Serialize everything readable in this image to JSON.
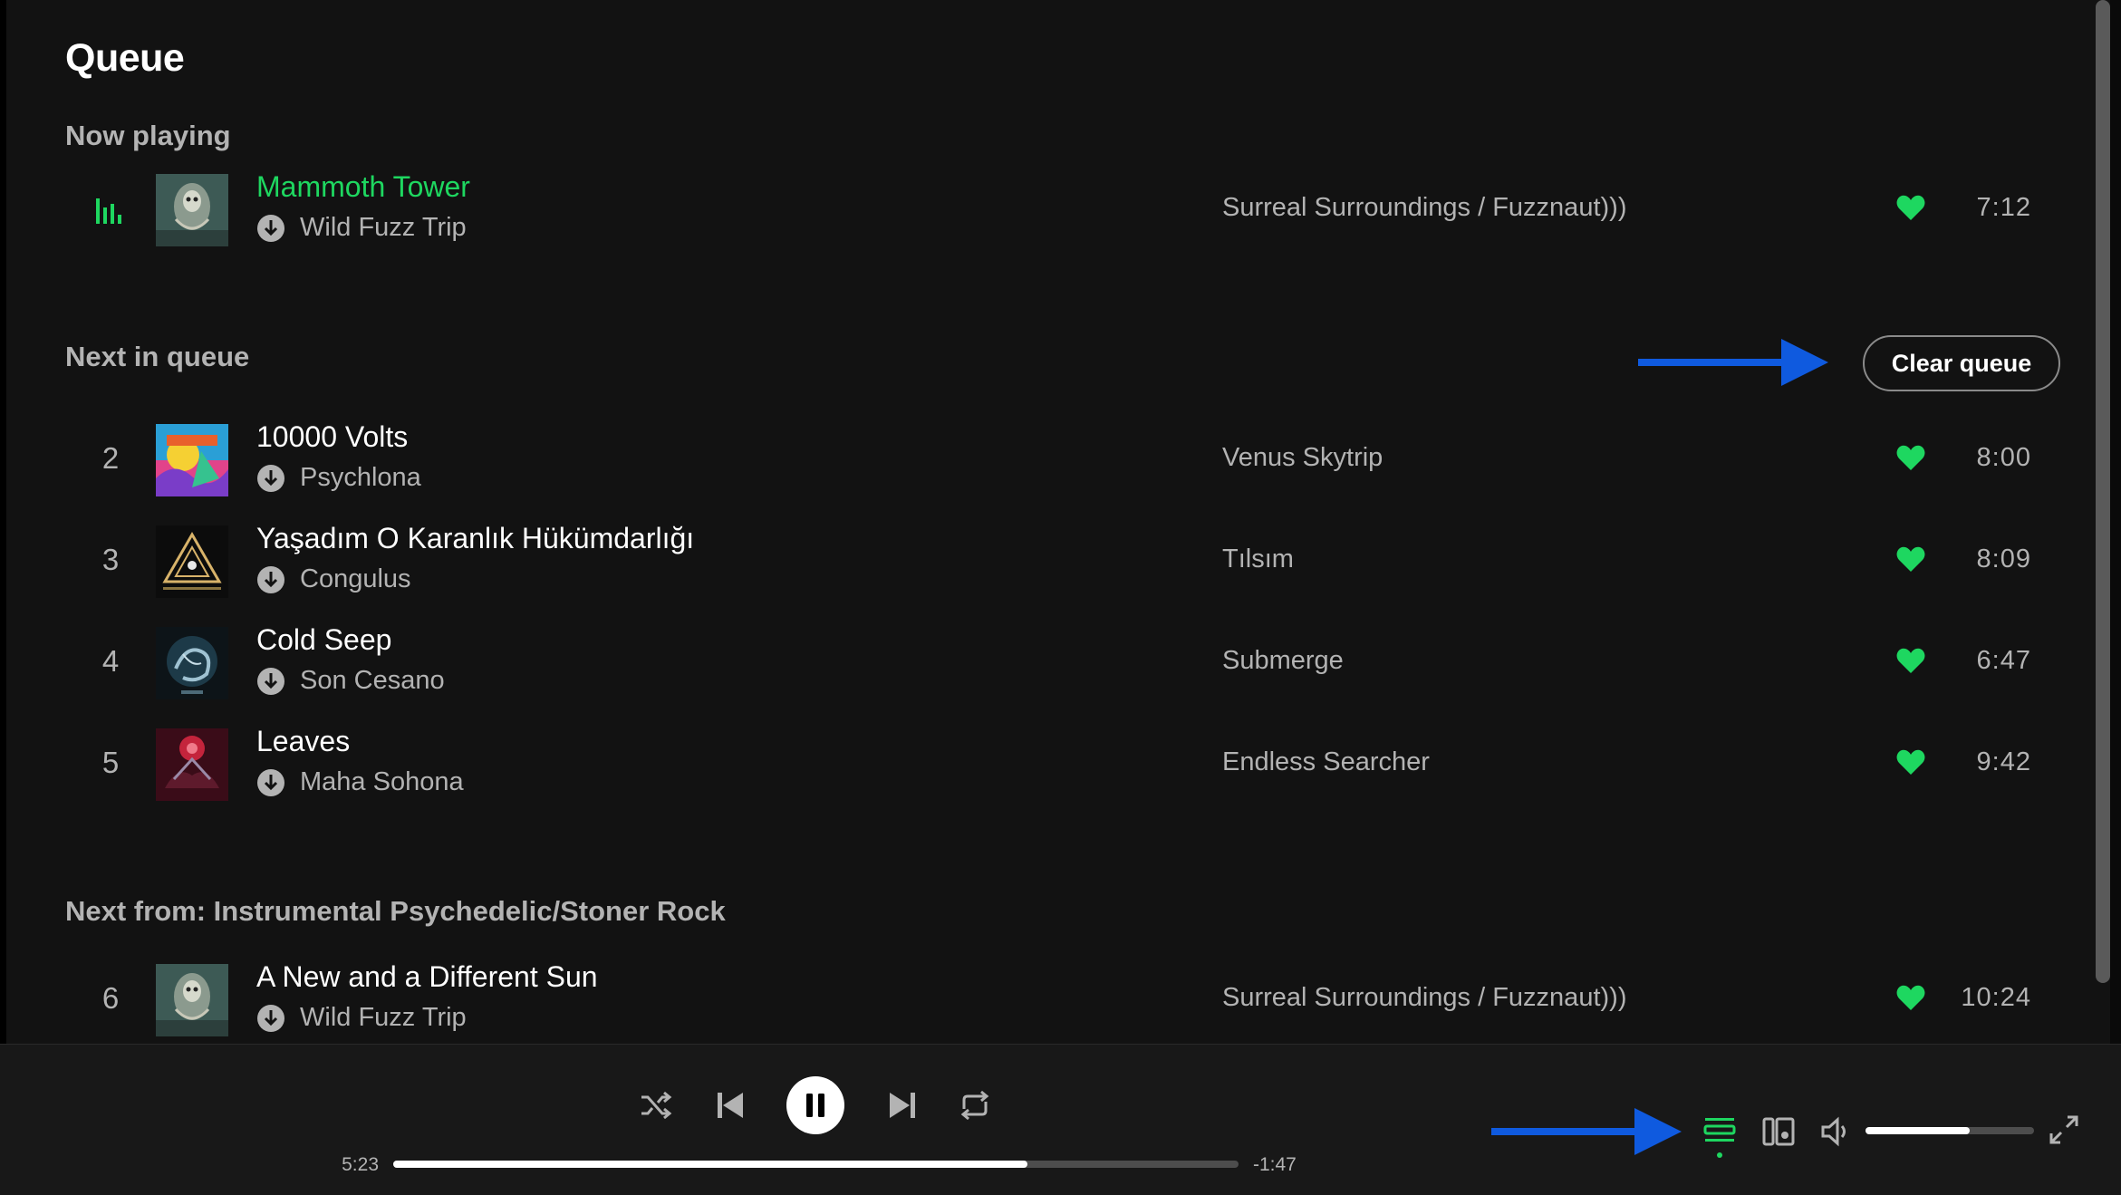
{
  "page": {
    "title": "Queue"
  },
  "sections": {
    "now_playing": "Now playing",
    "next_in_queue": "Next in queue",
    "next_from": "Next from: Instrumental Psychedelic/Stoner Rock"
  },
  "now_playing": {
    "title": "Mammoth Tower",
    "artist": "Wild Fuzz Trip",
    "album": "Surreal Surroundings / Fuzznaut)))",
    "duration": "7:12"
  },
  "queue": [
    {
      "index": "2",
      "title": "10000 Volts",
      "artist": "Psychlona",
      "album": "Venus Skytrip",
      "duration": "8:00"
    },
    {
      "index": "3",
      "title": "Yaşadım O Karanlık Hükümdarlığı",
      "artist": "Congulus",
      "album": "Tılsım",
      "duration": "8:09"
    },
    {
      "index": "4",
      "title": "Cold Seep",
      "artist": "Son Cesano",
      "album": "Submerge",
      "duration": "6:47"
    },
    {
      "index": "5",
      "title": "Leaves",
      "artist": "Maha Sohona",
      "album": "Endless Searcher",
      "duration": "9:42"
    }
  ],
  "next_from_tracks": [
    {
      "index": "6",
      "title": "A New and a Different Sun",
      "artist": "Wild Fuzz Trip",
      "album": "Surreal Surroundings / Fuzznaut)))",
      "duration": "10:24"
    }
  ],
  "actions": {
    "clear_queue": "Clear queue"
  },
  "player": {
    "elapsed": "5:23",
    "remaining": "-1:47",
    "progress": 0.75,
    "volume": 0.62
  },
  "colors": {
    "accent": "#1ed760",
    "annotation": "#0f5adf",
    "background": "#121212"
  },
  "icons": [
    "playing-bars-icon",
    "download-icon",
    "heart-icon",
    "shuffle-icon",
    "previous-icon",
    "pause-icon",
    "next-icon",
    "repeat-icon",
    "queue-icon",
    "connect-device-icon",
    "volume-icon",
    "fullscreen-icon"
  ]
}
